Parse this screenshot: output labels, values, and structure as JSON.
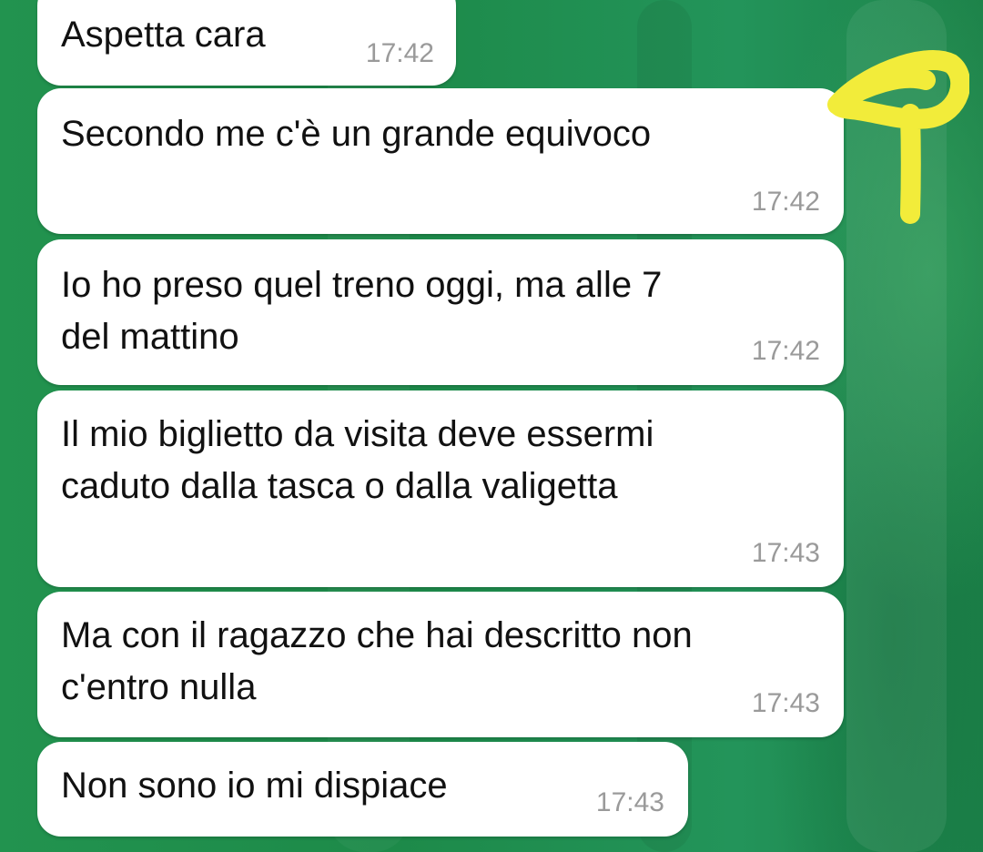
{
  "chat": {
    "messages": [
      {
        "text": "Aspetta cara",
        "time": "17:42"
      },
      {
        "text": "Secondo me c'è un grande equivoco",
        "time": "17:42"
      },
      {
        "text": "Io ho preso quel treno oggi, ma alle 7\ndel mattino",
        "time": "17:42"
      },
      {
        "text": "Il mio biglietto da visita deve essermi\ncaduto dalla tasca o dalla valigetta",
        "time": "17:43"
      },
      {
        "text": "Ma con il ragazzo che hai descritto non\nc'entro nulla",
        "time": "17:43"
      },
      {
        "text": "Non sono io mi dispiace",
        "time": "17:43"
      }
    ]
  },
  "annotation": {
    "color": "#f2ec3a"
  }
}
